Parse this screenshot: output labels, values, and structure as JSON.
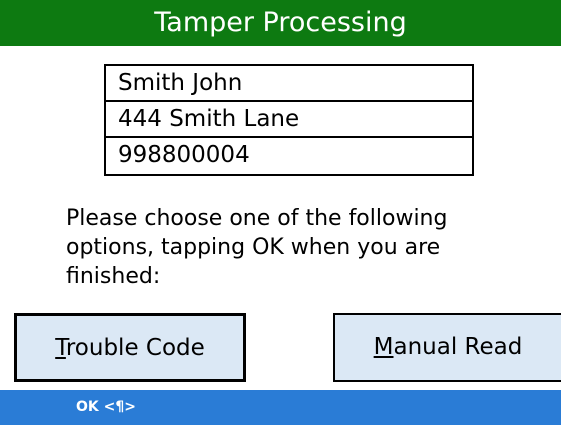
{
  "title": "Tamper Processing",
  "customer": {
    "name": "Smith John",
    "address": "444 Smith Lane",
    "account": "998800004"
  },
  "instructions": "Please choose one of the following options, tapping OK when you are finished:",
  "buttons": {
    "trouble_code": {
      "mnemonic": "T",
      "rest": "rouble Code"
    },
    "manual_read": {
      "mnemonic": "M",
      "rest": "anual Read"
    }
  },
  "status_bar": {
    "ok_label": "OK <¶>"
  },
  "colors": {
    "title_bar": "#0d7a11",
    "button_bg": "#dbe8f5",
    "status_bar": "#2a7cd6"
  }
}
